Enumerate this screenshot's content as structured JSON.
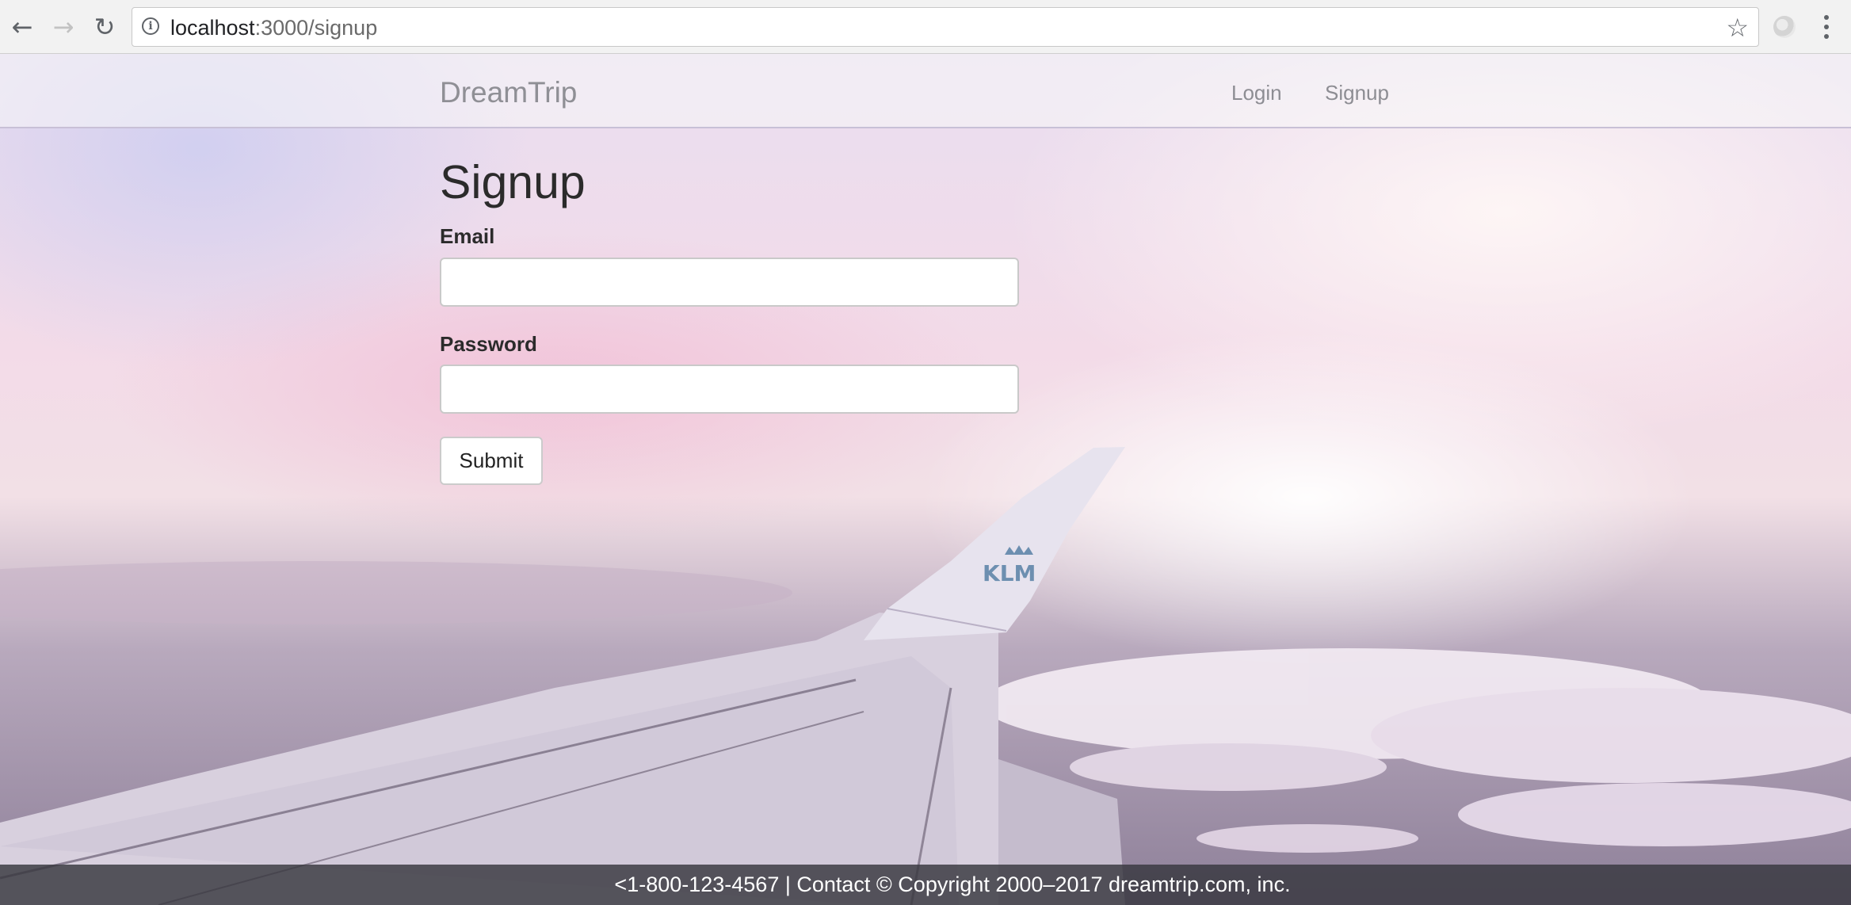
{
  "browser": {
    "url_host": "localhost",
    "url_rest": ":3000/signup",
    "icons": {
      "back": "arrow-left-icon",
      "forward": "arrow-right-icon",
      "reload": "reload-icon",
      "info": "info-icon",
      "bookmark": "star-icon",
      "extension": "extension-icon",
      "menu": "kebab-menu-icon"
    }
  },
  "navbar": {
    "brand": "DreamTrip",
    "links": [
      {
        "label": "Login"
      },
      {
        "label": "Signup"
      }
    ]
  },
  "form": {
    "title": "Signup",
    "email_label": "Email",
    "email_value": "",
    "password_label": "Password",
    "password_value": "",
    "submit_label": "Submit"
  },
  "background": {
    "wing_logo": "KLM"
  },
  "footer": {
    "text": "<1-800-123-4567 | Contact © Copyright 2000–2017 dreamtrip.com, inc."
  },
  "colors": {
    "sky_top": "#e9def0",
    "sky_pink": "#f3dbe8",
    "cloud_base": "#8e8099",
    "footer_bg": "#37373e",
    "wing_logo": "#6d8fb0"
  }
}
